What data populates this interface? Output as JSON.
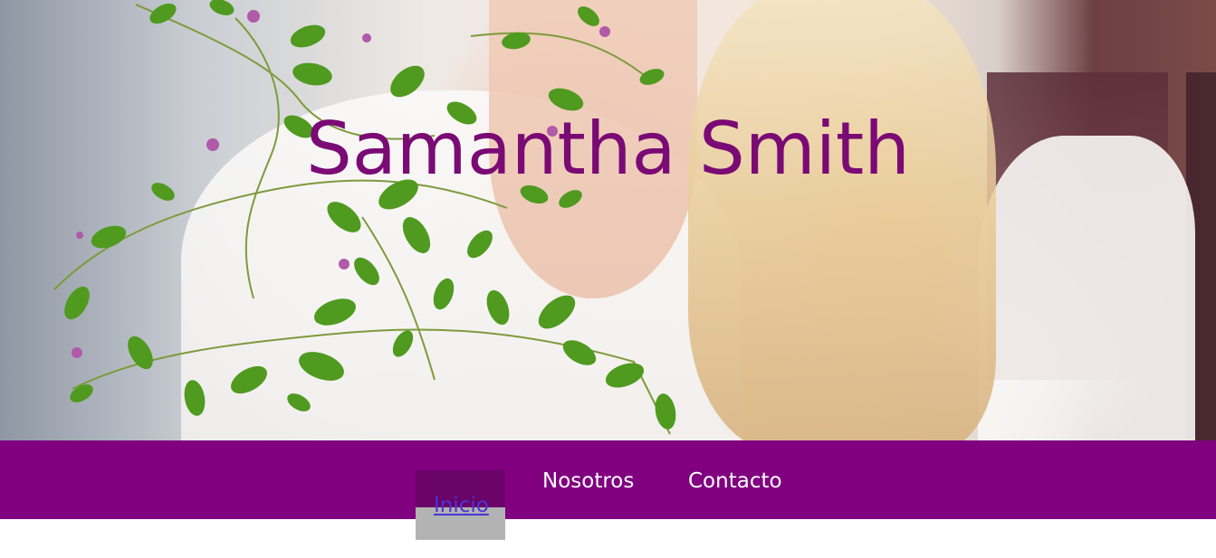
{
  "hero": {
    "title": "Samantha Smith"
  },
  "nav": {
    "items": [
      {
        "label": "Inicio",
        "active": true
      },
      {
        "label": "Nosotros",
        "active": false
      },
      {
        "label": "Contacto",
        "active": false
      }
    ]
  },
  "colors": {
    "brand": "#800080",
    "title": "#7a0a74",
    "active_tab": "#6a0469",
    "active_link": "#4b34d6"
  }
}
